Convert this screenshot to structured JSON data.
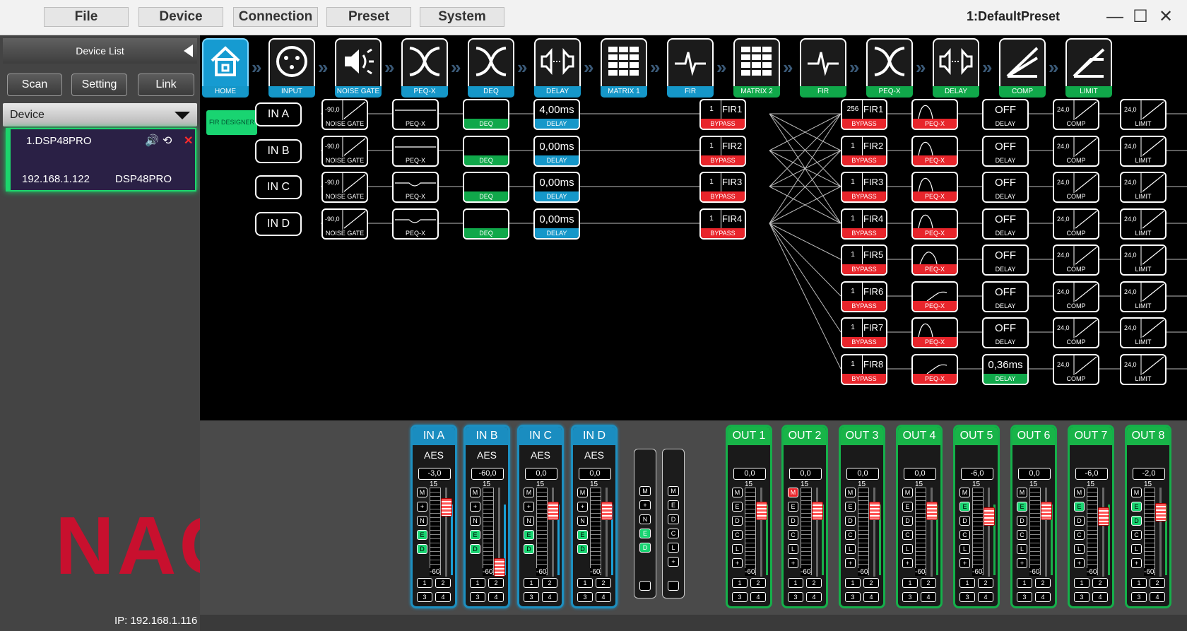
{
  "menu": {
    "items": [
      "File",
      "Device",
      "Connection",
      "Preset",
      "System"
    ],
    "preset_name": "1:DefaultPreset"
  },
  "sidebar": {
    "header": "Device List",
    "buttons": [
      "Scan",
      "Setting",
      "Link"
    ],
    "device_select": "Device",
    "device": {
      "name": "1.DSP48PRO",
      "ip": "192.168.1.122",
      "model": "DSP48PRO"
    },
    "logo": "NAG",
    "status_ip": "IP: 192.168.1.116"
  },
  "modules": [
    {
      "label": "HOME",
      "color": "blue",
      "icon": "home-icon"
    },
    {
      "label": "INPUT",
      "color": "blue",
      "icon": "xlr-input-icon"
    },
    {
      "label": "NOISE GATE",
      "color": "blue",
      "icon": "speaker-icon"
    },
    {
      "label": "PEQ-X",
      "color": "blue",
      "icon": "crossover-icon"
    },
    {
      "label": "DEQ",
      "color": "blue",
      "icon": "crossover-icon"
    },
    {
      "label": "DELAY",
      "color": "blue",
      "icon": "delay-icon"
    },
    {
      "label": "MATRIX 1",
      "color": "blue",
      "icon": "matrix-icon"
    },
    {
      "label": "FIR",
      "color": "blue",
      "icon": "fir-icon"
    },
    {
      "label": "MATRIX 2",
      "color": "green",
      "icon": "matrix-icon"
    },
    {
      "label": "FIR",
      "color": "green",
      "icon": "fir-icon"
    },
    {
      "label": "PEQ-X",
      "color": "green",
      "icon": "crossover-icon"
    },
    {
      "label": "DELAY",
      "color": "green",
      "icon": "delay-icon"
    },
    {
      "label": "COMP",
      "color": "green",
      "icon": "comp-icon"
    },
    {
      "label": "LIMIT",
      "color": "green",
      "icon": "limit-icon"
    }
  ],
  "fir_designer": "FIR DESIGNER",
  "inputs": [
    {
      "name": "IN A",
      "ng_value": "-90,0",
      "ng_label": "NOISE GATE",
      "peq_label": "PEQ-X",
      "deq_label": "DEQ",
      "delay": "4,00ms",
      "delay_label": "DELAY",
      "fir_idx": "1",
      "fir_name": "FIR1",
      "fir_label": "BYPASS"
    },
    {
      "name": "IN B",
      "ng_value": "-90,0",
      "ng_label": "NOISE GATE",
      "peq_label": "PEQ-X",
      "deq_label": "DEQ",
      "delay": "0,00ms",
      "delay_label": "DELAY",
      "fir_idx": "1",
      "fir_name": "FIR2",
      "fir_label": "BYPASS"
    },
    {
      "name": "IN C",
      "ng_value": "-90,0",
      "ng_label": "NOISE GATE",
      "peq_label": "PEQ-X",
      "deq_label": "DEQ",
      "delay": "0,00ms",
      "delay_label": "DELAY",
      "fir_idx": "1",
      "fir_name": "FIR3",
      "fir_label": "BYPASS"
    },
    {
      "name": "IN D",
      "ng_value": "-90,0",
      "ng_label": "NOISE GATE",
      "peq_label": "PEQ-X",
      "deq_label": "DEQ",
      "delay": "0,00ms",
      "delay_label": "DELAY",
      "fir_idx": "1",
      "fir_name": "FIR4",
      "fir_label": "BYPASS"
    }
  ],
  "outputs": [
    {
      "fir_idx": "256",
      "fir_name": "FIR1",
      "fir_label": "BYPASS",
      "peq_label": "PEQ-X",
      "delay": "OFF",
      "delay_label": "DELAY",
      "comp_val": "24,0",
      "comp_label": "COMP",
      "limit_val": "24,0",
      "limit_label": "LIMIT"
    },
    {
      "fir_idx": "1",
      "fir_name": "FIR2",
      "fir_label": "BYPASS",
      "peq_label": "PEQ-X",
      "delay": "OFF",
      "delay_label": "DELAY",
      "comp_val": "24,0",
      "comp_label": "COMP",
      "limit_val": "24,0",
      "limit_label": "LIMIT"
    },
    {
      "fir_idx": "1",
      "fir_name": "FIR3",
      "fir_label": "BYPASS",
      "peq_label": "PEQ-X",
      "delay": "OFF",
      "delay_label": "DELAY",
      "comp_val": "24,0",
      "comp_label": "COMP",
      "limit_val": "24,0",
      "limit_label": "LIMIT"
    },
    {
      "fir_idx": "1",
      "fir_name": "FIR4",
      "fir_label": "BYPASS",
      "peq_label": "PEQ-X",
      "delay": "OFF",
      "delay_label": "DELAY",
      "comp_val": "24,0",
      "comp_label": "COMP",
      "limit_val": "24,0",
      "limit_label": "LIMIT"
    },
    {
      "fir_idx": "1",
      "fir_name": "FIR5",
      "fir_label": "BYPASS",
      "peq_label": "PEQ-X",
      "delay": "OFF",
      "delay_label": "DELAY",
      "comp_val": "24,0",
      "comp_label": "COMP",
      "limit_val": "24,0",
      "limit_label": "LIMIT"
    },
    {
      "fir_idx": "1",
      "fir_name": "FIR6",
      "fir_label": "BYPASS",
      "peq_label": "PEQ-X",
      "delay": "OFF",
      "delay_label": "DELAY",
      "comp_val": "24,0",
      "comp_label": "COMP",
      "limit_val": "24,0",
      "limit_label": "LIMIT"
    },
    {
      "fir_idx": "1",
      "fir_name": "FIR7",
      "fir_label": "BYPASS",
      "peq_label": "PEQ-X",
      "delay": "OFF",
      "delay_label": "DELAY",
      "comp_val": "24,0",
      "comp_label": "COMP",
      "limit_val": "24,0",
      "limit_label": "LIMIT"
    },
    {
      "fir_idx": "1",
      "fir_name": "FIR8",
      "fir_label": "BYPASS",
      "peq_label": "PEQ-X",
      "delay": "0,36ms",
      "delay_label": "DELAY",
      "comp_val": "24,0",
      "comp_label": "COMP",
      "limit_val": "24,0",
      "limit_label": "LIMIT"
    }
  ],
  "mixer": {
    "scale_top": "15",
    "scale_bottom": "-60",
    "route_labels": [
      "1",
      "2",
      "3",
      "4"
    ],
    "in_buttons": [
      "M",
      "+",
      "N",
      "E",
      "D"
    ],
    "out_buttons": [
      "M",
      "E",
      "D",
      "C",
      "L",
      "+"
    ],
    "link_col_1": [
      "M",
      "+",
      "N",
      "E",
      "D"
    ],
    "link_col_2": [
      "M",
      "E",
      "D",
      "C",
      "L",
      "+"
    ],
    "input_strips": [
      {
        "name": "IN A",
        "source": "AES",
        "gain": "-3,0",
        "level": 0.85,
        "on": [
          3,
          4
        ]
      },
      {
        "name": "IN B",
        "source": "AES",
        "gain": "-60,0",
        "level": 0.0,
        "on": [
          3,
          4
        ]
      },
      {
        "name": "IN C",
        "source": "AES",
        "gain": "0,0",
        "level": 0.8,
        "on": [
          3,
          4
        ]
      },
      {
        "name": "IN D",
        "source": "AES",
        "gain": "0,0",
        "level": 0.8,
        "on": [
          3,
          4
        ]
      }
    ],
    "output_strips": [
      {
        "name": "OUT 1",
        "gain": "0,0",
        "level": 0.8,
        "on": [],
        "mute": false
      },
      {
        "name": "OUT 2",
        "gain": "0,0",
        "level": 0.8,
        "on": [],
        "mute": true
      },
      {
        "name": "OUT 3",
        "gain": "0,0",
        "level": 0.8,
        "on": [],
        "mute": false
      },
      {
        "name": "OUT 4",
        "gain": "0,0",
        "level": 0.8,
        "on": [],
        "mute": false
      },
      {
        "name": "OUT 5",
        "gain": "-6,0",
        "level": 0.72,
        "on": [
          1
        ],
        "mute": false
      },
      {
        "name": "OUT 6",
        "gain": "0,0",
        "level": 0.8,
        "on": [
          1
        ],
        "mute": false
      },
      {
        "name": "OUT 7",
        "gain": "-6,0",
        "level": 0.72,
        "on": [
          1
        ],
        "mute": false
      },
      {
        "name": "OUT 8",
        "gain": "-2,0",
        "level": 0.78,
        "on": [
          1,
          2
        ],
        "mute": false
      }
    ]
  },
  "colors": {
    "accent_blue": "#1597c9",
    "accent_green": "#10a84a",
    "bypass_red": "#e8252b",
    "logo_red": "#c8102e"
  }
}
